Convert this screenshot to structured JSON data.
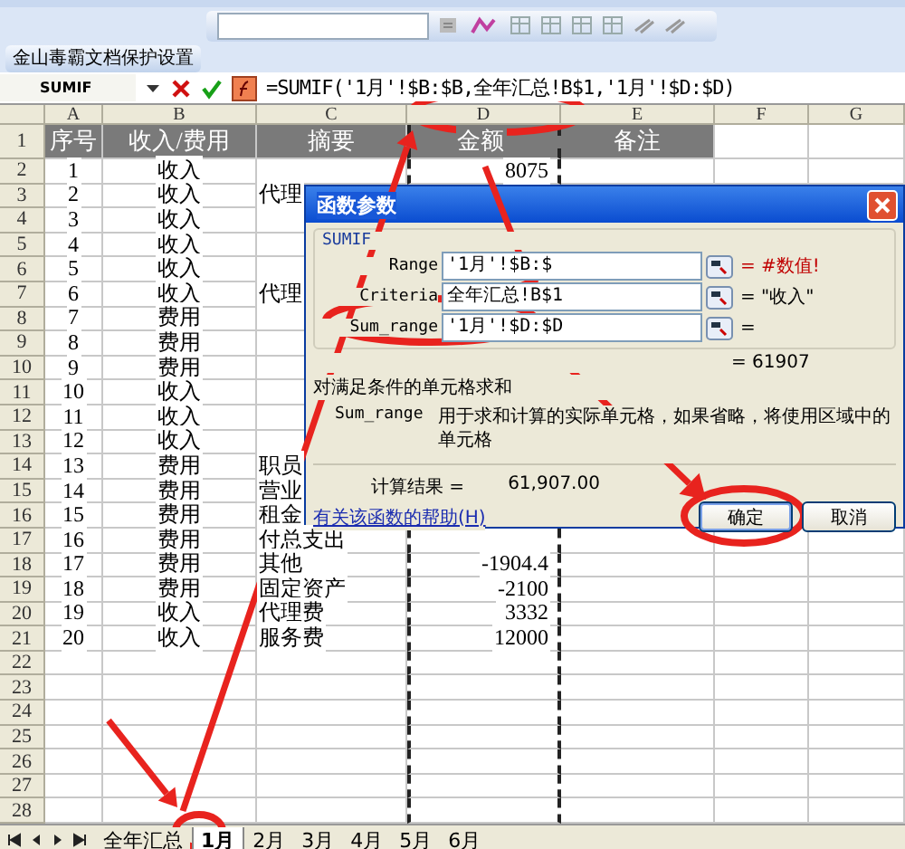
{
  "doc_toolbar": {
    "label": "金山毒霸文档保护设置"
  },
  "formula_bar": {
    "name_box": "SUMIF",
    "formula": "=SUMIF('1月'!$B:$B,全年汇总!B$1,'1月'!$D:$D)"
  },
  "columns": [
    "A",
    "B",
    "C",
    "D",
    "E",
    "F",
    "G"
  ],
  "rows": [
    {
      "number": "1",
      "kind": "header",
      "cells": {
        "a": "序号",
        "b": "收入/费用",
        "c": "摘要",
        "d": "金额",
        "e": "备注"
      }
    },
    {
      "number": "2",
      "kind": "data",
      "cells": {
        "a": "1",
        "b": "收入",
        "d": "8075"
      }
    },
    {
      "number": "3",
      "kind": "data",
      "cells": {
        "a": "2",
        "b": "收入",
        "c": "代理"
      }
    },
    {
      "number": "4",
      "kind": "data",
      "cells": {
        "a": "3",
        "b": "收入"
      }
    },
    {
      "number": "5",
      "kind": "data",
      "cells": {
        "a": "4",
        "b": "收入"
      }
    },
    {
      "number": "6",
      "kind": "data",
      "cells": {
        "a": "5",
        "b": "收入"
      }
    },
    {
      "number": "7",
      "kind": "data",
      "cells": {
        "a": "6",
        "b": "收入",
        "c": "代理"
      }
    },
    {
      "number": "8",
      "kind": "data",
      "cells": {
        "a": "7",
        "b": "费用"
      }
    },
    {
      "number": "9",
      "kind": "data",
      "cells": {
        "a": "8",
        "b": "费用"
      }
    },
    {
      "number": "10",
      "kind": "data",
      "cells": {
        "a": "9",
        "b": "费用"
      }
    },
    {
      "number": "11",
      "kind": "data",
      "cells": {
        "a": "10",
        "b": "收入"
      }
    },
    {
      "number": "12",
      "kind": "data",
      "cells": {
        "a": "11",
        "b": "收入"
      }
    },
    {
      "number": "13",
      "kind": "data",
      "cells": {
        "a": "12",
        "b": "收入"
      }
    },
    {
      "number": "14",
      "kind": "data",
      "cells": {
        "a": "13",
        "b": "费用",
        "c": "职员"
      }
    },
    {
      "number": "15",
      "kind": "data",
      "cells": {
        "a": "14",
        "b": "费用",
        "c": "营业"
      }
    },
    {
      "number": "16",
      "kind": "data",
      "cells": {
        "a": "15",
        "b": "费用",
        "c": "租金"
      }
    },
    {
      "number": "17",
      "kind": "data",
      "cells": {
        "a": "16",
        "b": "费用",
        "c": "付总支出"
      }
    },
    {
      "number": "18",
      "kind": "data",
      "cells": {
        "a": "17",
        "b": "费用",
        "c": "其他",
        "d": "-1904.4"
      }
    },
    {
      "number": "19",
      "kind": "data",
      "cells": {
        "a": "18",
        "b": "费用",
        "c": "固定资产",
        "d": "-2100"
      }
    },
    {
      "number": "20",
      "kind": "data",
      "cells": {
        "a": "19",
        "b": "收入",
        "c": "代理费",
        "d": "3332"
      }
    },
    {
      "number": "21",
      "kind": "data",
      "cells": {
        "a": "20",
        "b": "收入",
        "c": "服务费",
        "d": "12000"
      }
    },
    {
      "number": "22",
      "kind": "data",
      "cells": {}
    },
    {
      "number": "23",
      "kind": "data",
      "cells": {}
    },
    {
      "number": "24",
      "kind": "data",
      "cells": {}
    },
    {
      "number": "25",
      "kind": "data",
      "cells": {}
    },
    {
      "number": "26",
      "kind": "data",
      "cells": {}
    },
    {
      "number": "27",
      "kind": "data",
      "cells": {}
    },
    {
      "number": "28",
      "kind": "data",
      "cells": {}
    }
  ],
  "dialog": {
    "title": "函数参数",
    "function": "SUMIF",
    "args": [
      {
        "label": "Range",
        "value": "'1月'!$B:$",
        "result": "= #数值!",
        "error": true
      },
      {
        "label": "Criteria",
        "value": "全年汇总!B$1",
        "result": "= \"收入\"",
        "error": false
      },
      {
        "label": "Sum_range",
        "value": "'1月'!$D:$D",
        "result": "=",
        "error": false
      }
    ],
    "formula_result": "= 61907",
    "description": "对满足条件的单元格求和",
    "arg_help": {
      "label": "Sum_range",
      "text": "用于求和计算的实际单元格，如果省略，将使用区域中的单元格"
    },
    "calc_result": {
      "label": "计算结果 =",
      "value": "61,907.00"
    },
    "help_link": "有关该函数的帮助(H)",
    "buttons": [
      {
        "label": "确定",
        "default": true
      },
      {
        "label": "取消",
        "default": false
      }
    ]
  },
  "sheet_tabs": [
    {
      "label": "全年汇总",
      "selected": false
    },
    {
      "label": "1月",
      "selected": true
    },
    {
      "label": "2月",
      "selected": false
    },
    {
      "label": "3月",
      "selected": false
    },
    {
      "label": "4月",
      "selected": false
    },
    {
      "label": "5月",
      "selected": false
    },
    {
      "label": "6月",
      "selected": false
    }
  ]
}
